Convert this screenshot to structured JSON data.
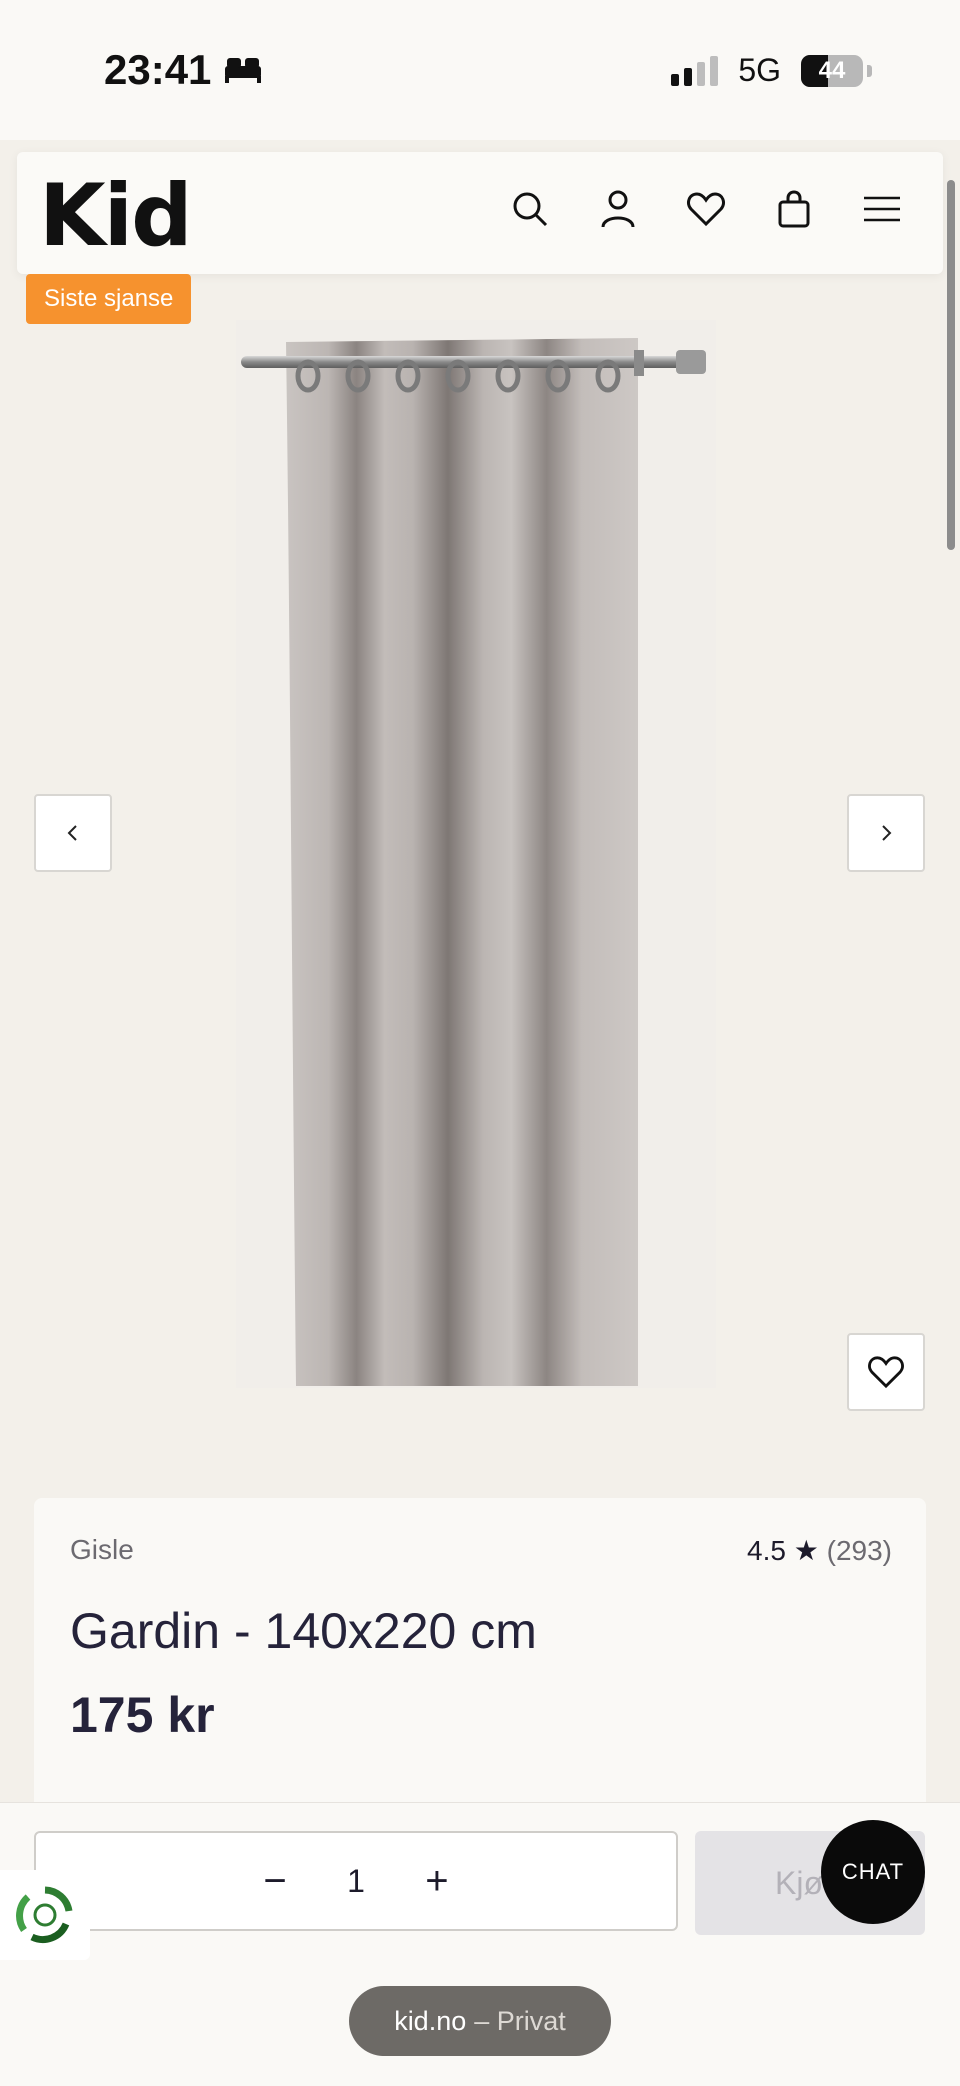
{
  "status_bar": {
    "time": "23:41",
    "network": "5G",
    "battery": "44",
    "battery_level": 0.44
  },
  "header": {
    "logo": "Kid",
    "icons": [
      "search-icon",
      "account-icon",
      "heart-icon",
      "bag-icon",
      "menu-icon"
    ]
  },
  "product": {
    "badge": "Siste sjanse",
    "brand": "Gisle",
    "rating": "4.5",
    "rating_star": "★",
    "review_count": "(293)",
    "title": "Gardin - 140x220 cm",
    "price": "175 kr"
  },
  "gallery": {
    "prev_icon": "chevron-left-icon",
    "next_icon": "chevron-right-icon",
    "favorite_icon": "heart-icon"
  },
  "cart_bar": {
    "minus": "−",
    "quantity": "1",
    "plus": "+",
    "buy_label": "Kjø"
  },
  "chat": {
    "label": "CHAT"
  },
  "browser": {
    "domain": "kid.no",
    "mode": "– Privat"
  },
  "colors": {
    "badge": "#f6922e",
    "background": "#f3f0ea",
    "text": "#1d1b2b"
  }
}
